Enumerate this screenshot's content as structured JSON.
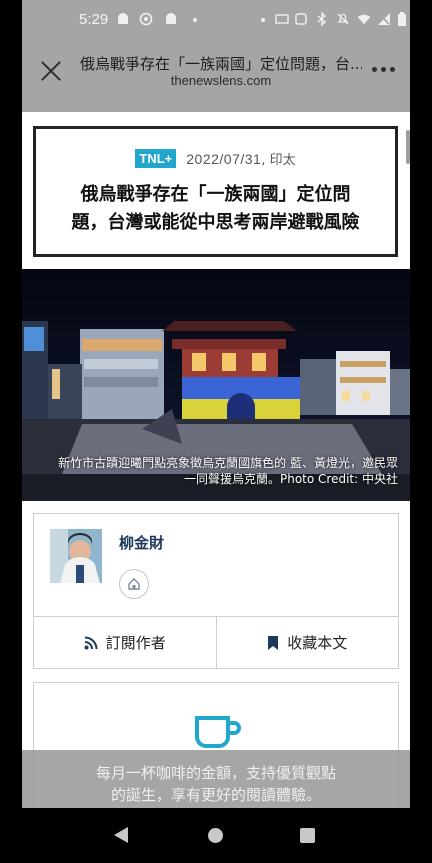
{
  "status_bar": {
    "time": "5:29",
    "left_icons": [
      "android-icon",
      "vpn-icon",
      "android-icon",
      "dot"
    ],
    "right_icons": [
      "dot",
      "battery-saver-icon",
      "nfc-icon",
      "bluetooth-icon",
      "mute-icon",
      "wifi-icon",
      "no-signal-icon",
      "battery-icon"
    ]
  },
  "browser": {
    "page_title": "俄烏戰爭存在「一族兩國」定位問題，台...",
    "domain": "thenewslens.com"
  },
  "article": {
    "badge": "TNL+",
    "date": "2022/07/31",
    "region": "印太",
    "headline_line1": "俄烏戰爭存在「一族兩國」定位問",
    "headline_line2": "題，台灣或能從中思考兩岸避戰風險",
    "caption_line1": "新竹市古蹟迎曦門點亮象徵烏克蘭國旗色的 藍、黃燈光，邀民眾",
    "caption_line2": "一同聲援烏克蘭。Photo Credit: 中央社"
  },
  "author": {
    "name": "柳金財"
  },
  "actions": {
    "subscribe": "訂閱作者",
    "bookmark": "收藏本文"
  },
  "support": {
    "line1": "每月一杯咖啡的金額，支持優質觀點",
    "line2": "的誕生，享有更好的閱讀體驗。"
  },
  "colors": {
    "accent": "#22a7cc",
    "author_name": "#1d3a5c",
    "gray_bar": "#a5a5a5"
  }
}
